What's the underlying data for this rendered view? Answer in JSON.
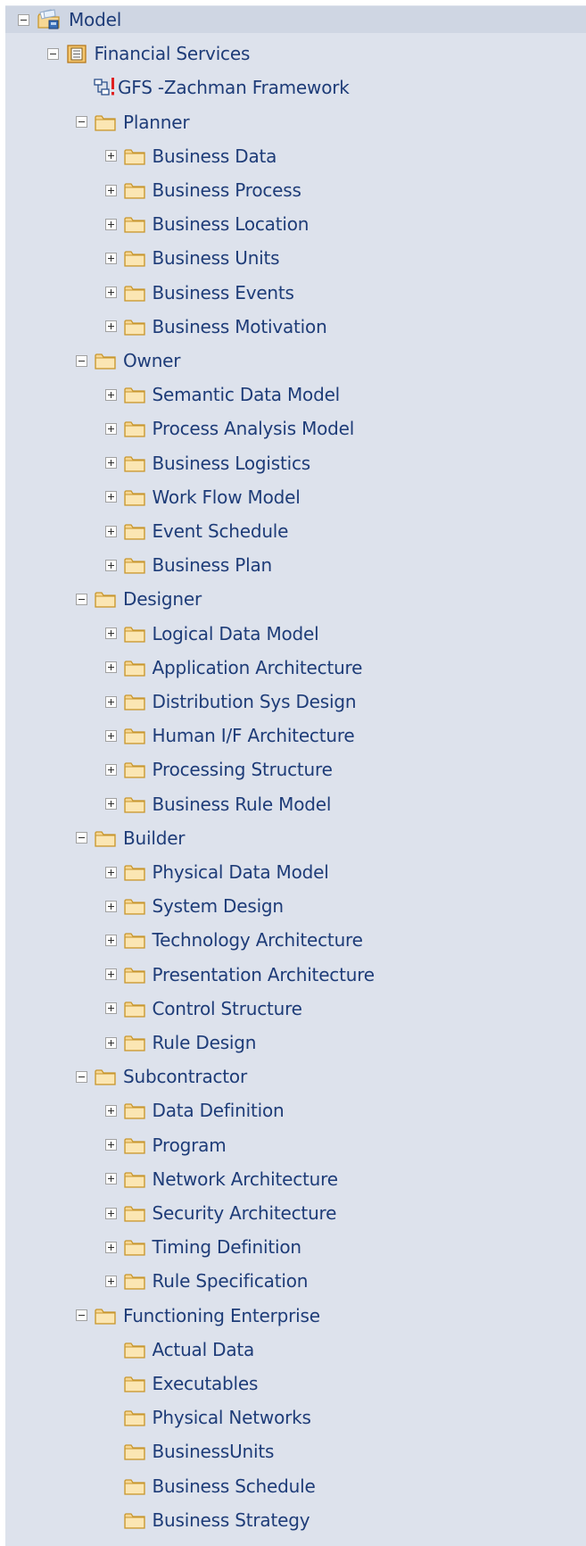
{
  "tree": [
    {
      "label": "Model",
      "icon": "model-root-icon",
      "level": 0,
      "expander": "minus",
      "name": "model"
    },
    {
      "label": "Financial Services",
      "icon": "package-icon",
      "level": 1,
      "expander": "minus",
      "name": "financial-services"
    },
    {
      "label": "GFS -Zachman Framework",
      "icon": "diagram-icon",
      "level": 2,
      "expander": "none",
      "name": "gfs-zachman-framework"
    },
    {
      "label": "Planner",
      "icon": "folder-icon",
      "level": 2,
      "expander": "minus",
      "name": "planner"
    },
    {
      "label": "Business Data",
      "icon": "folder-icon",
      "level": 3,
      "expander": "plus",
      "name": "business-data"
    },
    {
      "label": "Business Process",
      "icon": "folder-icon",
      "level": 3,
      "expander": "plus",
      "name": "business-process"
    },
    {
      "label": "Business Location",
      "icon": "folder-icon",
      "level": 3,
      "expander": "plus",
      "name": "business-location"
    },
    {
      "label": "Business Units",
      "icon": "folder-icon",
      "level": 3,
      "expander": "plus",
      "name": "business-units"
    },
    {
      "label": "Business Events",
      "icon": "folder-icon",
      "level": 3,
      "expander": "plus",
      "name": "business-events"
    },
    {
      "label": "Business Motivation",
      "icon": "folder-icon",
      "level": 3,
      "expander": "plus",
      "name": "business-motivation"
    },
    {
      "label": "Owner",
      "icon": "folder-icon",
      "level": 2,
      "expander": "minus",
      "name": "owner"
    },
    {
      "label": "Semantic Data Model",
      "icon": "folder-icon",
      "level": 3,
      "expander": "plus",
      "name": "semantic-data-model"
    },
    {
      "label": "Process Analysis Model",
      "icon": "folder-icon",
      "level": 3,
      "expander": "plus",
      "name": "process-analysis-model"
    },
    {
      "label": "Business Logistics",
      "icon": "folder-icon",
      "level": 3,
      "expander": "plus",
      "name": "business-logistics"
    },
    {
      "label": "Work Flow Model",
      "icon": "folder-icon",
      "level": 3,
      "expander": "plus",
      "name": "work-flow-model"
    },
    {
      "label": "Event Schedule",
      "icon": "folder-icon",
      "level": 3,
      "expander": "plus",
      "name": "event-schedule"
    },
    {
      "label": "Business Plan",
      "icon": "folder-icon",
      "level": 3,
      "expander": "plus",
      "name": "business-plan"
    },
    {
      "label": "Designer",
      "icon": "folder-icon",
      "level": 2,
      "expander": "minus",
      "name": "designer"
    },
    {
      "label": "Logical Data Model",
      "icon": "folder-icon",
      "level": 3,
      "expander": "plus",
      "name": "logical-data-model"
    },
    {
      "label": "Application Architecture",
      "icon": "folder-icon",
      "level": 3,
      "expander": "plus",
      "name": "application-architecture"
    },
    {
      "label": "Distribution Sys Design",
      "icon": "folder-icon",
      "level": 3,
      "expander": "plus",
      "name": "distribution-sys-design"
    },
    {
      "label": "Human I/F Architecture",
      "icon": "folder-icon",
      "level": 3,
      "expander": "plus",
      "name": "human-if-architecture"
    },
    {
      "label": "Processing Structure",
      "icon": "folder-icon",
      "level": 3,
      "expander": "plus",
      "name": "processing-structure"
    },
    {
      "label": "Business Rule Model",
      "icon": "folder-icon",
      "level": 3,
      "expander": "plus",
      "name": "business-rule-model"
    },
    {
      "label": "Builder",
      "icon": "folder-icon",
      "level": 2,
      "expander": "minus",
      "name": "builder"
    },
    {
      "label": "Physical Data Model",
      "icon": "folder-icon",
      "level": 3,
      "expander": "plus",
      "name": "physical-data-model"
    },
    {
      "label": "System Design",
      "icon": "folder-icon",
      "level": 3,
      "expander": "plus",
      "name": "system-design"
    },
    {
      "label": "Technology Architecture",
      "icon": "folder-icon",
      "level": 3,
      "expander": "plus",
      "name": "technology-architecture"
    },
    {
      "label": "Presentation Architecture",
      "icon": "folder-icon",
      "level": 3,
      "expander": "plus",
      "name": "presentation-architecture"
    },
    {
      "label": "Control Structure",
      "icon": "folder-icon",
      "level": 3,
      "expander": "plus",
      "name": "control-structure"
    },
    {
      "label": "Rule Design",
      "icon": "folder-icon",
      "level": 3,
      "expander": "plus",
      "name": "rule-design"
    },
    {
      "label": "Subcontractor",
      "icon": "folder-icon",
      "level": 2,
      "expander": "minus",
      "name": "subcontractor"
    },
    {
      "label": "Data Definition",
      "icon": "folder-icon",
      "level": 3,
      "expander": "plus",
      "name": "data-definition"
    },
    {
      "label": "Program",
      "icon": "folder-icon",
      "level": 3,
      "expander": "plus",
      "name": "program"
    },
    {
      "label": "Network Architecture",
      "icon": "folder-icon",
      "level": 3,
      "expander": "plus",
      "name": "network-architecture"
    },
    {
      "label": "Security Architecture",
      "icon": "folder-icon",
      "level": 3,
      "expander": "plus",
      "name": "security-architecture"
    },
    {
      "label": "Timing Definition",
      "icon": "folder-icon",
      "level": 3,
      "expander": "plus",
      "name": "timing-definition"
    },
    {
      "label": "Rule Specification",
      "icon": "folder-icon",
      "level": 3,
      "expander": "plus",
      "name": "rule-specification"
    },
    {
      "label": "Functioning Enterprise",
      "icon": "folder-icon",
      "level": 2,
      "expander": "minus",
      "name": "functioning-enterprise"
    },
    {
      "label": "Actual Data",
      "icon": "folder-icon",
      "level": 3,
      "expander": "none",
      "name": "actual-data"
    },
    {
      "label": "Executables",
      "icon": "folder-icon",
      "level": 3,
      "expander": "none",
      "name": "executables"
    },
    {
      "label": "Physical Networks",
      "icon": "folder-icon",
      "level": 3,
      "expander": "none",
      "name": "physical-networks"
    },
    {
      "label": "BusinessUnits",
      "icon": "folder-icon",
      "level": 3,
      "expander": "none",
      "name": "businessunits"
    },
    {
      "label": "Business Schedule",
      "icon": "folder-icon",
      "level": 3,
      "expander": "none",
      "name": "business-schedule"
    },
    {
      "label": "Business Strategy",
      "icon": "folder-icon",
      "level": 3,
      "expander": "none",
      "name": "business-strategy"
    }
  ],
  "colors": {
    "panel_bg": "#dde2ec",
    "text": "#1e3c78",
    "folder_fill": "#f7d794",
    "folder_stroke": "#c8972e"
  }
}
